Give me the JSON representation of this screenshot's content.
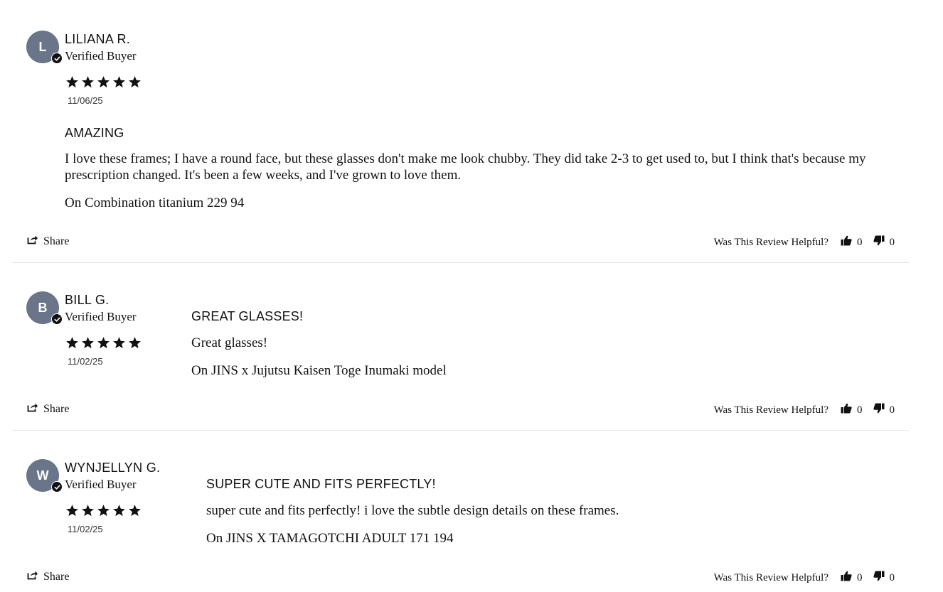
{
  "labels": {
    "share": "Share",
    "helpful_question": "Was This Review Helpful?"
  },
  "colors": {
    "avatar_bg": "#6b7589",
    "divider": "#e6e6e6",
    "text": "#111111"
  },
  "reviews": [
    {
      "initial": "L",
      "name": "LILIANA R.",
      "verified": "Verified Buyer",
      "rating": 5,
      "date": "11/06/25",
      "title": "AMAZING",
      "body": "I love these frames; I have a round face, but these glasses don't make me look chubby. They did take 2-3 to get used to, but I think that's because my prescription changed. It's been a few weeks, and I've grown to love them.",
      "product": "On Combination titanium 229 94",
      "upvotes": "0",
      "downvotes": "0"
    },
    {
      "initial": "B",
      "name": "BILL G.",
      "verified": "Verified Buyer",
      "rating": 5,
      "date": "11/02/25",
      "title": "GREAT GLASSES!",
      "body": "Great glasses!",
      "product": "On JINS x Jujutsu Kaisen Toge Inumaki model",
      "upvotes": "0",
      "downvotes": "0"
    },
    {
      "initial": "W",
      "name": "WYNJELLYN G.",
      "verified": "Verified Buyer",
      "rating": 5,
      "date": "11/02/25",
      "title": "SUPER CUTE AND FITS PERFECTLY!",
      "body": "super cute and fits perfectly! i love the subtle design details on these frames.",
      "product": "On JINS X TAMAGOTCHI ADULT 171 194",
      "upvotes": "0",
      "downvotes": "0"
    }
  ]
}
